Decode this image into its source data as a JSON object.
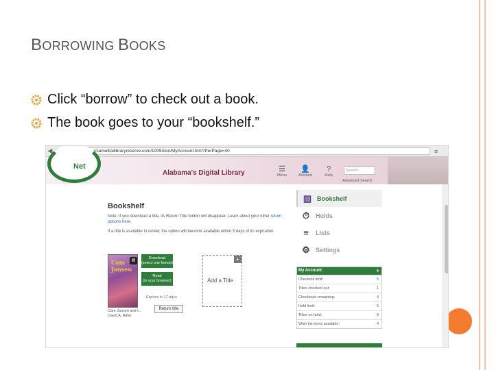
{
  "slide": {
    "title_first": "B",
    "title_rest1": "ORROWING ",
    "title_second": "B",
    "title_rest2": "OOKS",
    "bullets": [
      "Click “borrow” to check out a book.",
      "The book goes to your “bookshelf.”"
    ],
    "accent_color": "#f47c30",
    "bullet_color": "#e8a23c"
  },
  "browser": {
    "url": "https://camelliailibraryreserve.com/10053/en/MyAccount.htm?PerPage=40"
  },
  "site": {
    "logo_text": "Net",
    "name": "Alabama's Digital Library",
    "header_items": [
      {
        "icon": "menu-icon",
        "glyph": "☰",
        "label": "Menu"
      },
      {
        "icon": "account-icon",
        "glyph": "👤",
        "label": "Account"
      },
      {
        "icon": "help-icon",
        "glyph": "?",
        "label": "Help"
      }
    ],
    "search_placeholder": "Search...",
    "advanced_search": "Advanced Search"
  },
  "bookshelf": {
    "title": "Bookshelf",
    "note1_prefix": "Note: If you download a title, its Return Title button will disappear. Learn about your other ",
    "note1_link": "return options here.",
    "note2": "If a title is available to renew, the option will become available within 3 days of its expiration.",
    "book": {
      "cover_title": "Cam Jansen",
      "author_line1": "Cam Jansen and t...",
      "author_line2": "David A. Adler"
    },
    "download_label_line1": "Download",
    "download_label_line2": "(select one format)",
    "read_label_line1": "Read",
    "read_label_line2": "(in your browser)",
    "expires": "Expires in 17 days",
    "return_label": "Return title",
    "add_title_label": "Add a Title"
  },
  "side_nav": [
    {
      "icon": "bookshelf-icon",
      "glyph": "▥",
      "label": "Bookshelf",
      "active": true
    },
    {
      "icon": "holds-icon",
      "glyph": "⏱",
      "label": "Holds",
      "active": false
    },
    {
      "icon": "lists-icon",
      "glyph": "≡",
      "label": "Lists",
      "active": false
    },
    {
      "icon": "settings-icon",
      "glyph": "⚙",
      "label": "Settings",
      "active": false
    }
  ],
  "account": {
    "heading": "My Account:",
    "rows": [
      {
        "label": "Checkout limit:",
        "value": "5"
      },
      {
        "label": "Titles checked out:",
        "value": "1"
      },
      {
        "label": "Checkouts remaining:",
        "value": "4"
      },
      {
        "label": "Hold limit:",
        "value": "5"
      },
      {
        "label": "Titles on hold:",
        "value": "0"
      },
      {
        "label": "Wish list items available:",
        "value": "4"
      }
    ]
  }
}
